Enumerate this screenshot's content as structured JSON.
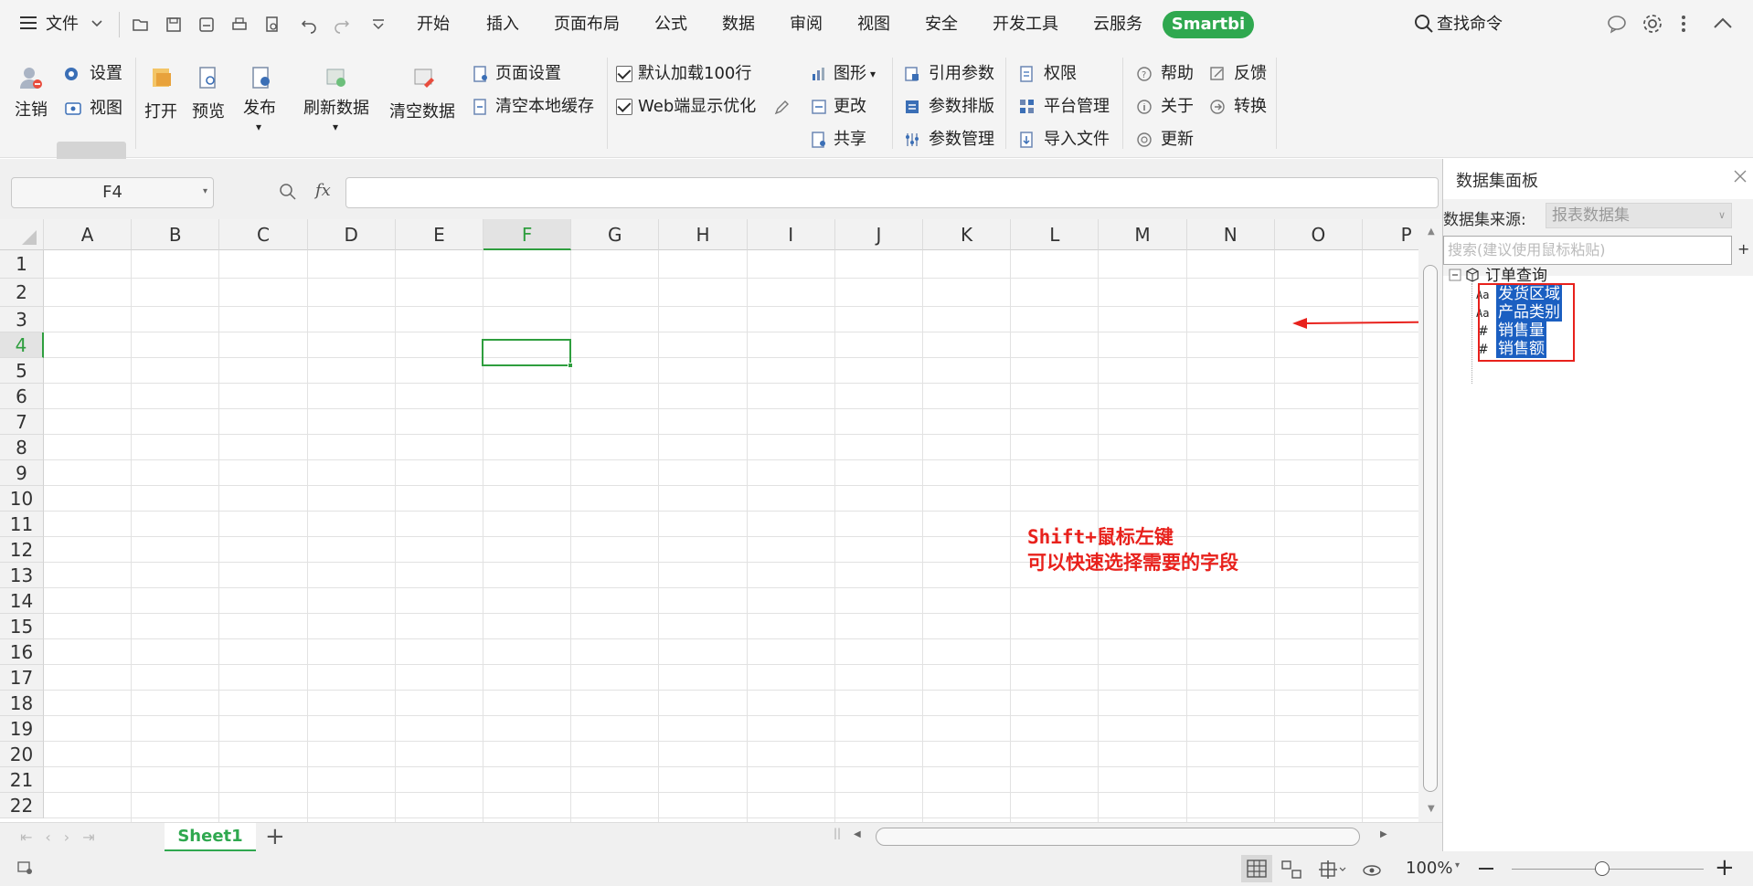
{
  "menubar": {
    "file_label": "文件",
    "tabs": [
      "开始",
      "插入",
      "页面布局",
      "公式",
      "数据",
      "审阅",
      "视图",
      "安全",
      "开发工具",
      "云服务"
    ],
    "smartbi_label": "Smartbi",
    "search_label": "查找命令"
  },
  "ribbon": {
    "logout": "注销",
    "settings": "设置",
    "view": "视图",
    "open": "打开",
    "preview": "预览",
    "publish": "发布",
    "refresh": "刷新数据",
    "clear": "清空数据",
    "page_setup": "页面设置",
    "clear_cache": "清空本地缓存",
    "load100": "默认加载100行",
    "web_opt": "Web端显示优化",
    "chart": "图形",
    "change": "更改",
    "share": "共享",
    "ref_param": "引用参数",
    "param_layout": "参数排版",
    "param_manage": "参数管理",
    "permission": "权限",
    "platform": "平台管理",
    "import": "导入文件",
    "help": "帮助",
    "about": "关于",
    "update": "更新",
    "feedback": "反馈",
    "convert": "转换"
  },
  "formula_bar": {
    "cell_ref": "F4",
    "fx": "fx",
    "value": ""
  },
  "sheet": {
    "columns": [
      "A",
      "B",
      "C",
      "D",
      "E",
      "F",
      "G",
      "H",
      "I",
      "J",
      "K",
      "L",
      "M",
      "N",
      "O",
      "P"
    ],
    "rows": [
      "1",
      "2",
      "3",
      "4",
      "5",
      "6",
      "7",
      "8",
      "9",
      "10",
      "11",
      "12",
      "13",
      "14",
      "15",
      "16",
      "17",
      "18",
      "19",
      "20",
      "21",
      "22"
    ],
    "active_col": "F",
    "active_row": "4"
  },
  "tabs": {
    "sheet1": "Sheet1",
    "add": "+"
  },
  "status": {
    "zoom": "100%"
  },
  "panel": {
    "title": "数据集面板",
    "source_label": "数据集来源:",
    "source_value": "报表数据集",
    "search_placeholder": "搜索(建议使用鼠标粘贴)",
    "add": "+",
    "root": "订单查询",
    "fields": [
      {
        "type": "Aa",
        "name": "发货区域"
      },
      {
        "type": "Aa",
        "name": "产品类别"
      },
      {
        "type": "#",
        "name": "销售量"
      },
      {
        "type": "#",
        "name": "销售额"
      }
    ]
  },
  "annotation": {
    "line1": "Shift+鼠标左键",
    "line2": "可以快速选择需要的字段"
  },
  "colors": {
    "accent_green": "#2fa84f",
    "selection_blue": "#1b5fc1",
    "annotation_red": "#e8211c"
  }
}
